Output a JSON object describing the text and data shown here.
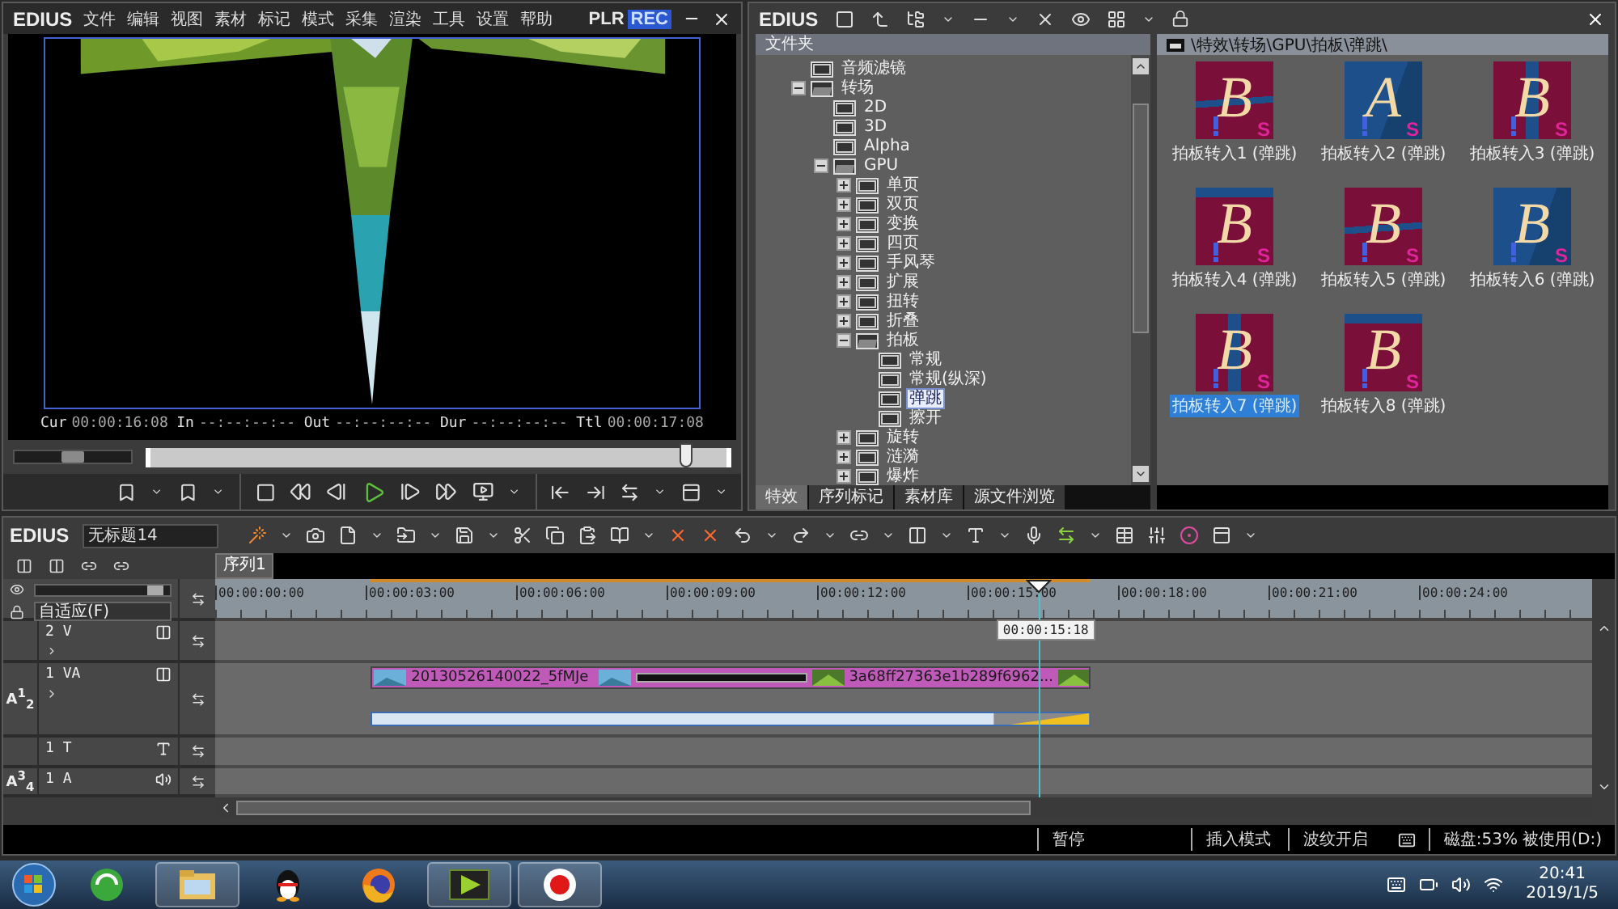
{
  "player": {
    "logo": "EDIUS",
    "menus": [
      "文件",
      "编辑",
      "视图",
      "素材",
      "标记",
      "模式",
      "采集",
      "渲染",
      "工具",
      "设置",
      "帮助"
    ],
    "modes": [
      {
        "label": "PLR",
        "selected": false
      },
      {
        "label": "REC",
        "selected": true
      }
    ],
    "monitor": {
      "kind": "picture"
    },
    "timecodes": [
      {
        "label": "Cur",
        "value": "00:00:16:08"
      },
      {
        "label": "In",
        "value": "--:--:--:--"
      },
      {
        "label": "Out",
        "value": "--:--:--:--"
      },
      {
        "label": "Dur",
        "value": "--:--:--:--"
      },
      {
        "label": "Ttl",
        "value": "00:00:17:08"
      }
    ],
    "jog": {
      "level": 0.5
    },
    "scrubber": {
      "level": 0.93
    }
  },
  "bin": {
    "logo": "EDIUS",
    "folder_header": "文件夹",
    "tree": [
      {
        "label": "音频滤镜",
        "selected": false
      },
      {
        "label": "转场",
        "expanded": true,
        "selected": false,
        "children": [
          {
            "label": "2D",
            "selected": false
          },
          {
            "label": "3D",
            "selected": false
          },
          {
            "label": "Alpha",
            "selected": false
          },
          {
            "label": "GPU",
            "expanded": true,
            "selected": false,
            "children": [
              {
                "label": "单页",
                "expanded": false,
                "selected": false
              },
              {
                "label": "双页",
                "expanded": false,
                "selected": false
              },
              {
                "label": "变换",
                "expanded": false,
                "selected": false
              },
              {
                "label": "四页",
                "expanded": false,
                "selected": false
              },
              {
                "label": "手风琴",
                "expanded": false,
                "selected": false
              },
              {
                "label": "扩展",
                "expanded": false,
                "selected": false
              },
              {
                "label": "扭转",
                "expanded": false,
                "selected": false
              },
              {
                "label": "折叠",
                "expanded": false,
                "selected": false
              },
              {
                "label": "拍板",
                "expanded": true,
                "selected": false,
                "children": [
                  {
                    "label": "常规",
                    "selected": false
                  },
                  {
                    "label": "常规(纵深)",
                    "selected": false
                  },
                  {
                    "label": "弹跳",
                    "selected": true
                  },
                  {
                    "label": "擦开",
                    "selected": false
                  }
                ]
              },
              {
                "label": "旋转",
                "expanded": false,
                "selected": false
              },
              {
                "label": "涟漪",
                "expanded": false,
                "selected": false
              },
              {
                "label": "爆炸",
                "expanded": false,
                "selected": false
              }
            ]
          }
        ]
      }
    ],
    "tabs": [
      {
        "label": "特效",
        "selected": true
      },
      {
        "label": "序列标记",
        "selected": false
      },
      {
        "label": "素材库",
        "selected": false
      },
      {
        "label": "源文件浏览",
        "selected": false
      }
    ],
    "path": "\\特效\\转场\\GPU\\拍板\\弹跳\\",
    "effects": [
      {
        "label": "拍板转入1 (弹跳)",
        "letter": "B",
        "badge": "S",
        "selected": false
      },
      {
        "label": "拍板转入2 (弹跳)",
        "letter": "A",
        "badge": "S",
        "selected": false
      },
      {
        "label": "拍板转入3 (弹跳)",
        "letter": "B",
        "badge": "S",
        "selected": false
      },
      {
        "label": "拍板转入4 (弹跳)",
        "letter": "B",
        "badge": "S",
        "selected": false
      },
      {
        "label": "拍板转入5 (弹跳)",
        "letter": "B",
        "badge": "S",
        "selected": false
      },
      {
        "label": "拍板转入6 (弹跳)",
        "letter": "B",
        "badge": "S",
        "selected": false
      },
      {
        "label": "拍板转入7 (弹跳)",
        "letter": "B",
        "badge": "S",
        "selected": true
      },
      {
        "label": "拍板转入8 (弹跳)",
        "letter": "B",
        "badge": "S",
        "selected": false
      }
    ]
  },
  "timeline": {
    "logo": "EDIUS",
    "project": "无标题14",
    "sequence_tabs": [
      {
        "label": "序列1",
        "selected": true
      }
    ],
    "zoom": {
      "level": 0.95
    },
    "fit_mode": "自适应(F)",
    "ruler": [
      "00:00:00:00",
      "00:00:03:00",
      "00:00:06:00",
      "00:00:09:00",
      "00:00:12:00",
      "00:00:15:00",
      "00:00:18:00",
      "00:00:21:00",
      "00:00:24:00"
    ],
    "playhead": {
      "level": 0.598
    },
    "tooltip": "00:00:15:18",
    "tracks": [
      {
        "name": "2 V",
        "kind": "video"
      },
      {
        "name": "1 VA",
        "kind": "va",
        "patch": "A$^{1}$$_{2}$",
        "clip": {
          "names": [
            "20130526140022_5fMJe",
            "3a68ff27363e1b289f6962..."
          ]
        }
      },
      {
        "name": "1 T",
        "kind": "title"
      },
      {
        "name": "1 A",
        "kind": "audio",
        "patch": "A$^{3}$$_{4}$"
      }
    ],
    "status": [
      "暂停",
      "插入模式",
      "波纹开启",
      "磁盘:53% 被使用(D:)"
    ]
  },
  "taskbar": {
    "apps": [
      {
        "kind": "browser",
        "running": false
      },
      {
        "kind": "explorer",
        "running": true
      },
      {
        "kind": "penguin",
        "running": false
      },
      {
        "kind": "firefox",
        "running": false
      },
      {
        "kind": "editor",
        "running": true
      },
      {
        "kind": "recorder",
        "running": true
      }
    ],
    "time": "20:41",
    "date": "2019/1/5"
  }
}
